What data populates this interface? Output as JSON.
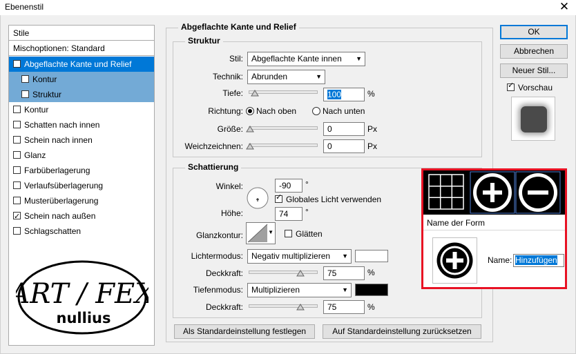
{
  "window": {
    "title": "Ebenenstil",
    "close_glyph": "✕"
  },
  "styles_panel": {
    "header": "Stile",
    "blend_options": "Mischoptionen: Standard",
    "items": [
      {
        "label": "Abgeflachte Kante und Relief",
        "checked": true,
        "state": "selected"
      },
      {
        "label": "Kontur",
        "checked": false,
        "state": "sub"
      },
      {
        "label": "Struktur",
        "checked": false,
        "state": "sub"
      },
      {
        "label": "Kontur",
        "checked": false
      },
      {
        "label": "Schatten nach innen",
        "checked": false
      },
      {
        "label": "Schein nach innen",
        "checked": false
      },
      {
        "label": "Glanz",
        "checked": false
      },
      {
        "label": "Farbüberlagerung",
        "checked": false
      },
      {
        "label": "Verlaufsüberlagerung",
        "checked": false
      },
      {
        "label": "Musterüberlagerung",
        "checked": false
      },
      {
        "label": "Schein nach außen",
        "checked": true
      },
      {
        "label": "Schlagschatten",
        "checked": false
      }
    ],
    "logo": {
      "line1": "ART / FEX",
      "line2": "nullius"
    }
  },
  "main": {
    "group_title": "Abgeflachte Kante und Relief",
    "structure": {
      "title": "Struktur",
      "style_label": "Stil:",
      "style_value": "Abgeflachte Kante innen",
      "technique_label": "Technik:",
      "technique_value": "Abrunden",
      "depth_label": "Tiefe:",
      "depth_value": "100",
      "depth_unit": "%",
      "direction_label": "Richtung:",
      "direction_up": "Nach oben",
      "direction_down": "Nach unten",
      "size_label": "Größe:",
      "size_value": "0",
      "size_unit": "Px",
      "soften_label": "Weichzeichnen:",
      "soften_value": "0",
      "soften_unit": "Px"
    },
    "shading": {
      "title": "Schattierung",
      "angle_label": "Winkel:",
      "angle_value": "-90",
      "angle_unit": "°",
      "global_light_label": "Globales Licht verwenden",
      "altitude_label": "Höhe:",
      "altitude_value": "74",
      "altitude_unit": "°",
      "gloss_label": "Glanzkontur:",
      "antialias_label": "Glätten",
      "highlight_label": "Lichtermodus:",
      "highlight_value": "Negativ multiplizieren",
      "highlight_opacity_label": "Deckkraft:",
      "highlight_opacity_value": "75",
      "highlight_opacity_unit": "%",
      "shadow_label": "Tiefenmodus:",
      "shadow_value": "Multiplizieren",
      "shadow_opacity_label": "Deckkraft:",
      "shadow_opacity_value": "75",
      "shadow_opacity_unit": "%"
    },
    "make_default": "Als Standardeinstellung festlegen",
    "reset_default": "Auf Standardeinstellung zurücksetzen"
  },
  "right": {
    "ok": "OK",
    "cancel": "Abbrechen",
    "new_style": "Neuer Stil...",
    "preview_label": "Vorschau"
  },
  "shape_popup": {
    "name_of_shape": "Name der Form",
    "name_label": "Name:",
    "name_value": "Hinzufügen"
  },
  "colors": {
    "accent": "#0078d7",
    "subsel": "#73aad6",
    "highlight_red": "#e81123"
  }
}
